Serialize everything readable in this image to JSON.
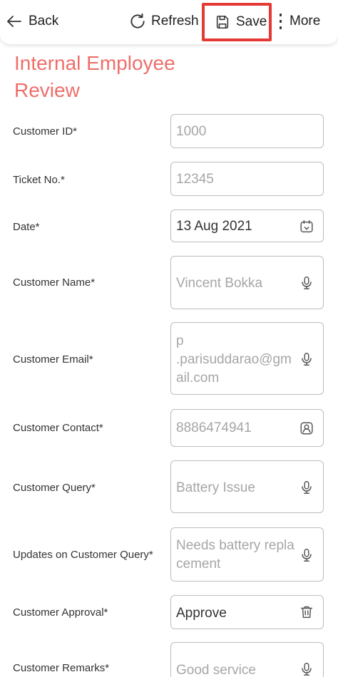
{
  "toolbar": {
    "back_label": "Back",
    "refresh_label": "Refresh",
    "save_label": "Save",
    "more_label": "More",
    "highlight_color": "#e53935"
  },
  "page": {
    "title": "Internal Employee Review",
    "title_color": "#ee6e6a"
  },
  "fields": {
    "customer_id": {
      "label": "Customer ID*",
      "value": "1000"
    },
    "ticket_no": {
      "label": "Ticket No.*",
      "value": "12345"
    },
    "date": {
      "label": "Date*",
      "value": "13 Aug 2021",
      "icon": "calendar-icon"
    },
    "customer_name": {
      "label": "Customer Name*",
      "value": "Vincent Bokka",
      "icon": "microphone-icon"
    },
    "customer_email": {
      "label": "Customer Email*",
      "value": "p\n.parisuddarao@gmail.com",
      "icon": "microphone-icon"
    },
    "customer_contact": {
      "label": "Customer Contact*",
      "value": "8886474941",
      "icon": "contact-icon"
    },
    "customer_query": {
      "label": "Customer Query*",
      "value": "Battery Issue",
      "icon": "microphone-icon"
    },
    "updates_query": {
      "label": "Updates on Customer Query*",
      "value": "Needs battery replacement",
      "icon": "microphone-icon"
    },
    "customer_approval": {
      "label": "Customer Approval*",
      "value": "Approve",
      "icon": "trash-icon"
    },
    "customer_remarks": {
      "label": "Customer Remarks*",
      "value": "Good service",
      "icon": "microphone-icon"
    }
  }
}
